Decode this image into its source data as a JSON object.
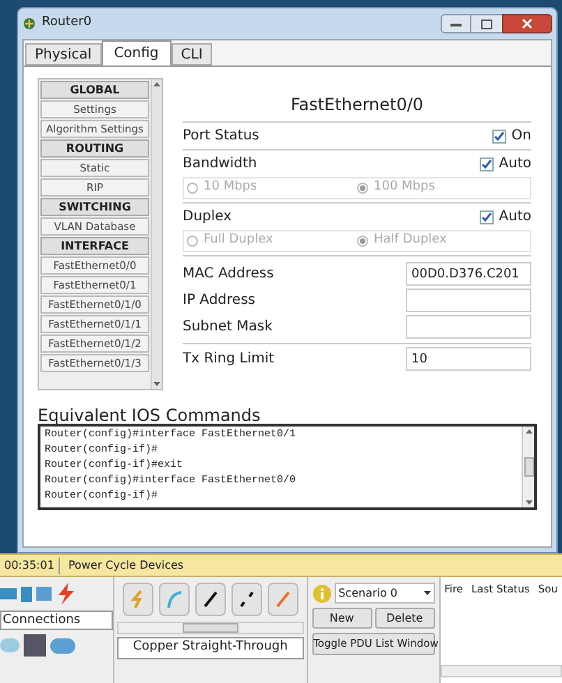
{
  "window": {
    "title": "Router0"
  },
  "tabs": [
    {
      "label": "Physical",
      "selected": false
    },
    {
      "label": "Config",
      "selected": true
    },
    {
      "label": "CLI",
      "selected": false
    }
  ],
  "sidebar": {
    "items": [
      {
        "kind": "header",
        "label": "GLOBAL"
      },
      {
        "kind": "item",
        "label": "Settings"
      },
      {
        "kind": "item",
        "label": "Algorithm Settings"
      },
      {
        "kind": "header",
        "label": "ROUTING"
      },
      {
        "kind": "item",
        "label": "Static"
      },
      {
        "kind": "item",
        "label": "RIP"
      },
      {
        "kind": "header",
        "label": "SWITCHING"
      },
      {
        "kind": "item",
        "label": "VLAN Database"
      },
      {
        "kind": "header",
        "label": "INTERFACE"
      },
      {
        "kind": "item",
        "label": "FastEthernet0/0"
      },
      {
        "kind": "item",
        "label": "FastEthernet0/1"
      },
      {
        "kind": "item",
        "label": "FastEthernet0/1/0"
      },
      {
        "kind": "item",
        "label": "FastEthernet0/1/1"
      },
      {
        "kind": "item",
        "label": "FastEthernet0/1/2"
      },
      {
        "kind": "item",
        "label": "FastEthernet0/1/3"
      }
    ]
  },
  "panel": {
    "title": "FastEthernet0/0",
    "port_status": {
      "label": "Port Status",
      "checkbox": "On",
      "checked": true
    },
    "bandwidth": {
      "label": "Bandwidth",
      "checkbox": "Auto",
      "checked": true,
      "options": [
        {
          "label": "10 Mbps",
          "selected": false
        },
        {
          "label": "100 Mbps",
          "selected": true
        }
      ]
    },
    "duplex": {
      "label": "Duplex",
      "checkbox": "Auto",
      "checked": true,
      "options": [
        {
          "label": "Full Duplex",
          "selected": false
        },
        {
          "label": "Half Duplex",
          "selected": true
        }
      ]
    },
    "fields": [
      {
        "label": "MAC Address",
        "value": "00D0.D376.C201"
      },
      {
        "label": "IP Address"
      },
      {
        "label": "Subnet Mask"
      },
      {
        "label": "Tx Ring Limit",
        "value": "10"
      }
    ]
  },
  "ios": {
    "title": "Equivalent IOS Commands",
    "lines": [
      "Router(config)#interface FastEthernet0/1",
      "Router(config-if)#",
      "Router(config-if)#exit",
      "Router(config)#interface FastEthernet0/0",
      "Router(config-if)#"
    ]
  },
  "status_bar": {
    "time": "00:35:01",
    "button": "Power Cycle Devices"
  },
  "bottom": {
    "category": "Connections",
    "cable_name": "Copper Straight-Through",
    "scenario": "Scenario 0",
    "buttons": [
      "New",
      "Delete"
    ],
    "toggle": "Toggle PDU List Window",
    "pdu_columns": [
      "Fire",
      "Last Status",
      "Sou"
    ]
  }
}
